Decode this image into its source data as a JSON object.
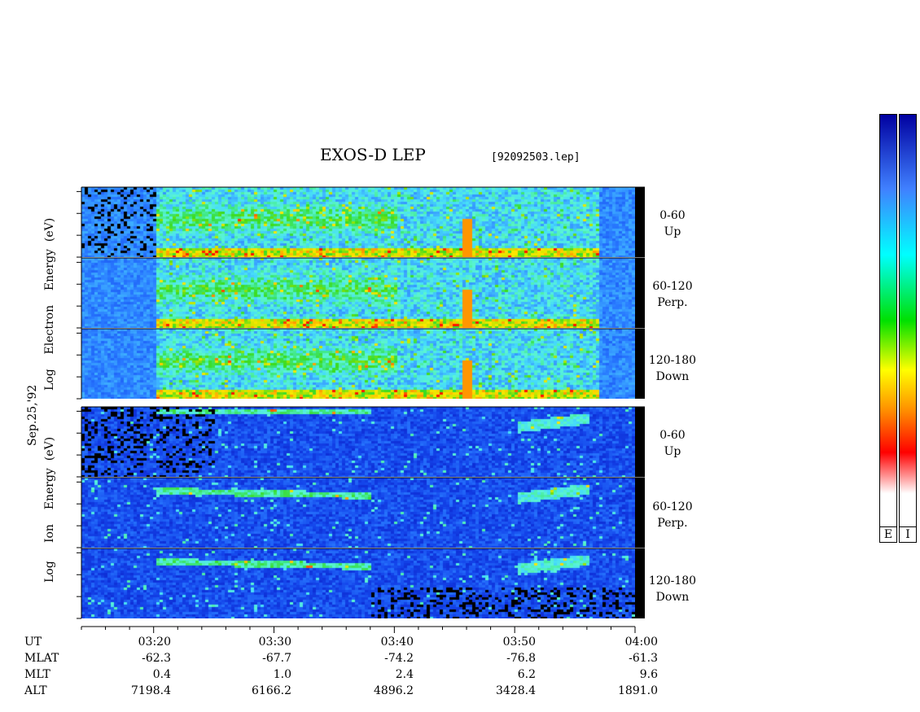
{
  "title": "EXOS-D LEP",
  "file": "[92092503.lep]",
  "date_label": "Sep.25,'92",
  "electron_axis_words": [
    "Log",
    "Electron",
    "Energy",
    "(eV)"
  ],
  "ion_axis_words": [
    "Log",
    "Ion",
    "Energy",
    "(eV)"
  ],
  "colorbar": {
    "labels": [
      "E",
      "I"
    ],
    "colors": [
      "#ffffff",
      "#ff0000",
      "#ff8c00",
      "#ffff00",
      "#00e000",
      "#00ffff",
      "#4080ff",
      "#0000a0"
    ]
  },
  "chart_data": {
    "type": "heatmap",
    "x": {
      "ticks": [
        "03:20",
        "03:30",
        "03:40",
        "03:50",
        "04:00"
      ],
      "range": [
        "03:14",
        "04:00"
      ]
    },
    "y": {
      "ticks": [
        2,
        3,
        4
      ],
      "range": [
        1,
        4.2
      ],
      "scale": "log10 eV"
    },
    "panels": [
      {
        "species": "Electron",
        "angle": "0-60",
        "direction": "Up"
      },
      {
        "species": "Electron",
        "angle": "60-120",
        "direction": "Perp."
      },
      {
        "species": "Electron",
        "angle": "120-180",
        "direction": "Down"
      },
      {
        "species": "Ion",
        "angle": "0-60",
        "direction": "Up"
      },
      {
        "species": "Ion",
        "angle": "60-120",
        "direction": "Perp."
      },
      {
        "species": "Ion",
        "angle": "120-180",
        "direction": "Down"
      }
    ],
    "ephemeris": {
      "rows": [
        {
          "name": "UT",
          "values": [
            "03:20",
            "03:30",
            "03:40",
            "03:50",
            "04:00"
          ]
        },
        {
          "name": "MLAT",
          "values": [
            "-62.3",
            "-67.7",
            "-74.2",
            "-76.8",
            "-61.3"
          ]
        },
        {
          "name": "MLT",
          "values": [
            "0.4",
            "1.0",
            "2.4",
            "6.2",
            "9.6"
          ]
        },
        {
          "name": "ALT",
          "values": [
            "7198.4",
            "6166.2",
            "4896.2",
            "3428.4",
            "1891.0"
          ]
        }
      ]
    }
  }
}
